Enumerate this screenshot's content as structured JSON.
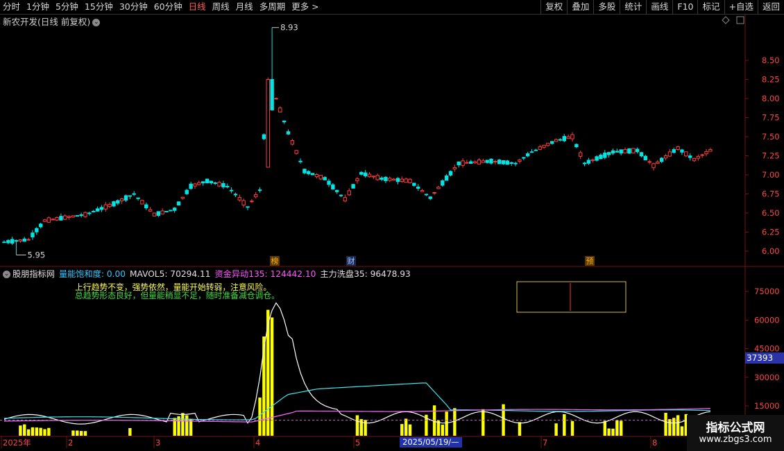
{
  "toolbar": {
    "periods": [
      "分时",
      "1分钟",
      "5分钟",
      "15分钟",
      "30分钟",
      "60分钟",
      "日线",
      "周线",
      "月线",
      "多周期",
      "更多 >"
    ],
    "active_period": "日线",
    "tools": [
      "复权",
      "叠加",
      "多股",
      "统计",
      "画线",
      "F10",
      "标记",
      "+自选",
      "返回"
    ]
  },
  "main": {
    "title": "新农开发(日线 前复权)",
    "max_label": "8.93",
    "min_label": "5.95",
    "price_ticks": [
      "8.50",
      "8.25",
      "8.00",
      "7.75",
      "7.50",
      "7.25",
      "7.00",
      "6.75",
      "6.50",
      "6.25",
      "6.00"
    ],
    "markers": [
      {
        "label": "榜",
        "color": "#ffb000",
        "bg": "#5a3a00"
      },
      {
        "label": "财",
        "color": "#a0c8ff",
        "bg": "#1a2a55"
      },
      {
        "label": "预",
        "color": "#ffb000",
        "bg": "#5a3a00"
      }
    ]
  },
  "indicator": {
    "name": "股朋指标网",
    "items": [
      {
        "text": "量能饱和度: 0.00",
        "color": "#33c6ff"
      },
      {
        "text": "MAVOL5: 70294.11",
        "color": "#e0e0e0"
      },
      {
        "text": "资金异动135: 124442.10",
        "color": "#ff55ff"
      },
      {
        "text": "主力洗盘35: 96478.93",
        "color": "#e0e0e0"
      }
    ],
    "hint_1": "上行趋势不变，强势依然，量能开始转弱，注意风险。",
    "hint_2": "总趋势形态良好，但量能稍显不足，随时准备减仓调仓。",
    "vol_ticks": [
      "75000",
      "60000",
      "45000",
      "30000",
      "15000"
    ],
    "current_value": "37393"
  },
  "timeline": {
    "labels": [
      "2025年",
      "2",
      "3",
      "4",
      "5",
      "7",
      "8"
    ],
    "selected_date": "2025/05/19/—"
  },
  "watermark": {
    "title": "指标公式网",
    "url": "www.zbgs3.com"
  },
  "colors": {
    "up": "#ff3c3c",
    "down": "#00e4e4",
    "vol": "#ffff00",
    "white_line": "#ffffff",
    "cyan_line": "#40e8f0",
    "pink_line": "#ff66ff",
    "grid": "#7a1010"
  }
}
